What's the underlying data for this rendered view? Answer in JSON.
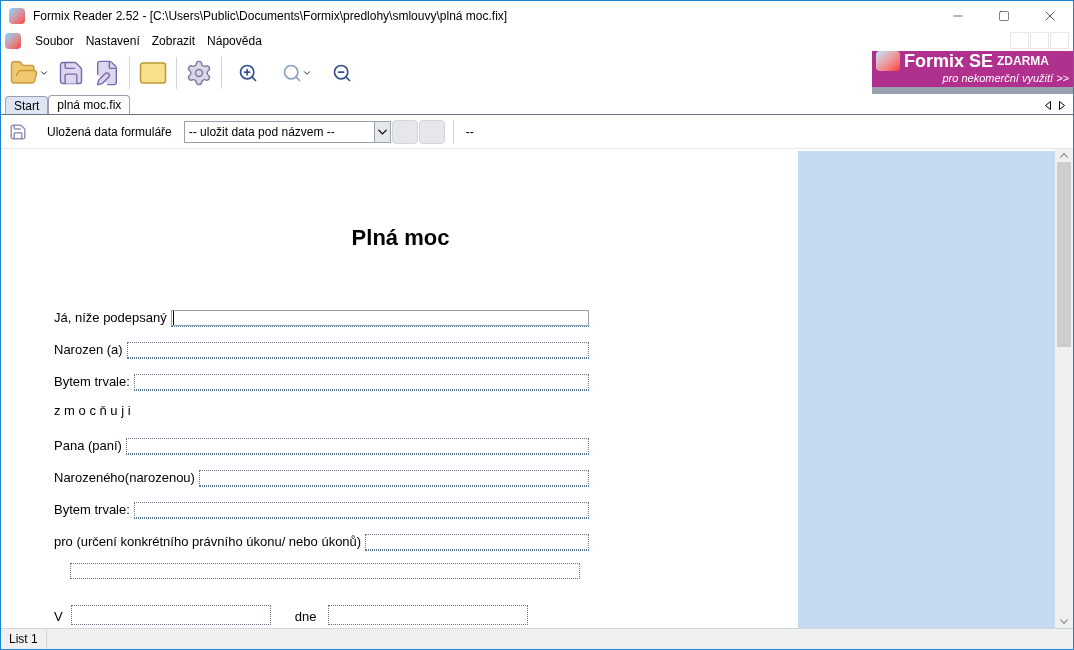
{
  "window": {
    "title": "Formix Reader 2.52 - [C:\\Users\\Public\\Documents\\Formix\\predlohy\\smlouvy\\plná moc.fix]"
  },
  "menu": [
    {
      "label": "Soubor"
    },
    {
      "label": "Nastavení"
    },
    {
      "label": "Zobrazit"
    },
    {
      "label": "Nápověda"
    }
  ],
  "banner": {
    "title": "Formix SE",
    "badge": "ZDARMA",
    "subtitle": "pro nekomerční využití >>"
  },
  "tabs": [
    {
      "label": "Start",
      "selected": false
    },
    {
      "label": "plná moc.fix",
      "selected": true
    }
  ],
  "form_toolbar": {
    "label": "Uložená data formuláře",
    "select_value": "-- uložit data pod názvem --",
    "status": "--"
  },
  "document": {
    "title": "Plná moc",
    "rows": [
      {
        "kind": "field",
        "label": "Já, níže podepsaný",
        "focused": true
      },
      {
        "kind": "field",
        "label": "Narozen (a)",
        "focused": false
      },
      {
        "kind": "field",
        "label": "Bytem trvale:",
        "focused": false
      },
      {
        "kind": "text",
        "label": "z m o c ň u j i"
      },
      {
        "kind": "field",
        "label": "Pana (paní)",
        "focused": false
      },
      {
        "kind": "field",
        "label": "Narozeného(narozenou)",
        "focused": false
      },
      {
        "kind": "field",
        "label": "Bytem trvale:",
        "focused": false
      },
      {
        "kind": "field",
        "label": "pro (určení konkrétního právního úkonu/ nebo úkonů)",
        "focused": false
      },
      {
        "kind": "wide",
        "focused": false
      }
    ],
    "place_label": "V",
    "date_label": "dne"
  },
  "status_bar": {
    "page": "List 1"
  }
}
